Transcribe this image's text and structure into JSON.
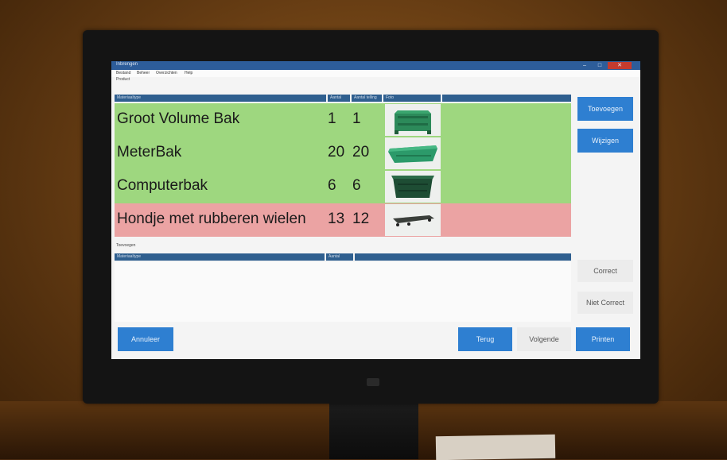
{
  "window": {
    "title": "Inbrengen",
    "minimize_glyph": "–",
    "maximize_glyph": "□",
    "close_glyph": "✕"
  },
  "menu": {
    "items": [
      "Bestand",
      "Beheer",
      "Overzichten",
      "Help"
    ]
  },
  "breadcrumb": "Product",
  "top_table": {
    "columns": [
      "Materiaaltype",
      "Aantal",
      "Aantal telling",
      "Foto"
    ],
    "rows": [
      {
        "name": "Groot Volume Bak",
        "aantal": "1",
        "telling": "1",
        "status": "ok",
        "image": "large-green-crate"
      },
      {
        "name": "MeterBak",
        "aantal": "20",
        "telling": "20",
        "status": "ok",
        "image": "long-green-tray"
      },
      {
        "name": "Computerbak",
        "aantal": "6",
        "telling": "6",
        "status": "ok",
        "image": "dark-green-bin"
      },
      {
        "name": "Hondje met rubberen wielen",
        "aantal": "13",
        "telling": "12",
        "status": "mismatch",
        "image": "wheeled-dolly"
      }
    ]
  },
  "section_label": "Toevoegen",
  "bottom_table": {
    "columns": [
      "Materiaaltype",
      "Aantal",
      ""
    ]
  },
  "buttons": {
    "toevoegen": "Toevoegen",
    "wijzigen": "Wijzigen",
    "correct": "Correct",
    "niet_correct": "Niet Correct",
    "annuleer": "Annuleer",
    "terug": "Terug",
    "volgende": "Volgende",
    "printen": "Printen"
  },
  "colors": {
    "row_ok": "#9ed77f",
    "row_mismatch": "#eba3a3",
    "accent_blue": "#2e7fd1",
    "header_blue": "#2f5f8f"
  }
}
